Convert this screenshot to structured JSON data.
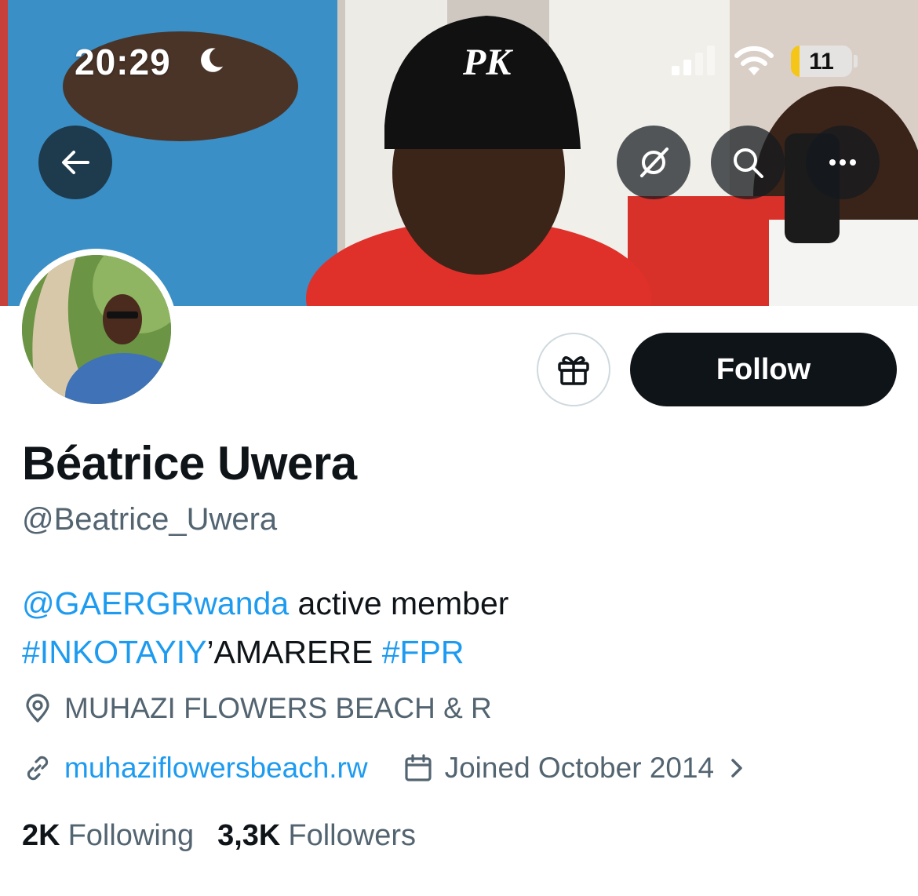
{
  "status_bar": {
    "time": "20:29",
    "battery": "11",
    "icons": [
      "moon-icon",
      "cellular-signal-icon",
      "wifi-icon",
      "battery-icon"
    ]
  },
  "header": {
    "buttons": [
      "back-arrow-icon",
      "grok-icon",
      "search-icon",
      "more-icon"
    ]
  },
  "profile": {
    "name": "Béatrice Uwera",
    "handle": "@Beatrice_Uwera",
    "follow_label": "Follow",
    "bio": {
      "mention": "@GAERGRwanda",
      "text1": " active member",
      "hashtag1": "#INKOTAYIY",
      "text2": "’AMARERE ",
      "hashtag2": "#FPR"
    },
    "location": "MUHAZI FLOWERS BEACH & R",
    "website": "muhaziflowersbeach.rw",
    "joined": "Joined October 2014",
    "following_count": "2K",
    "following_label": "Following",
    "followers_count": "3,3K",
    "followers_label": "Followers"
  },
  "colors": {
    "accent": "#1d9bf0",
    "text_primary": "#0f1419",
    "text_secondary": "#536471",
    "button_dark": "#0f1419",
    "battery_low": "#f5c518"
  }
}
